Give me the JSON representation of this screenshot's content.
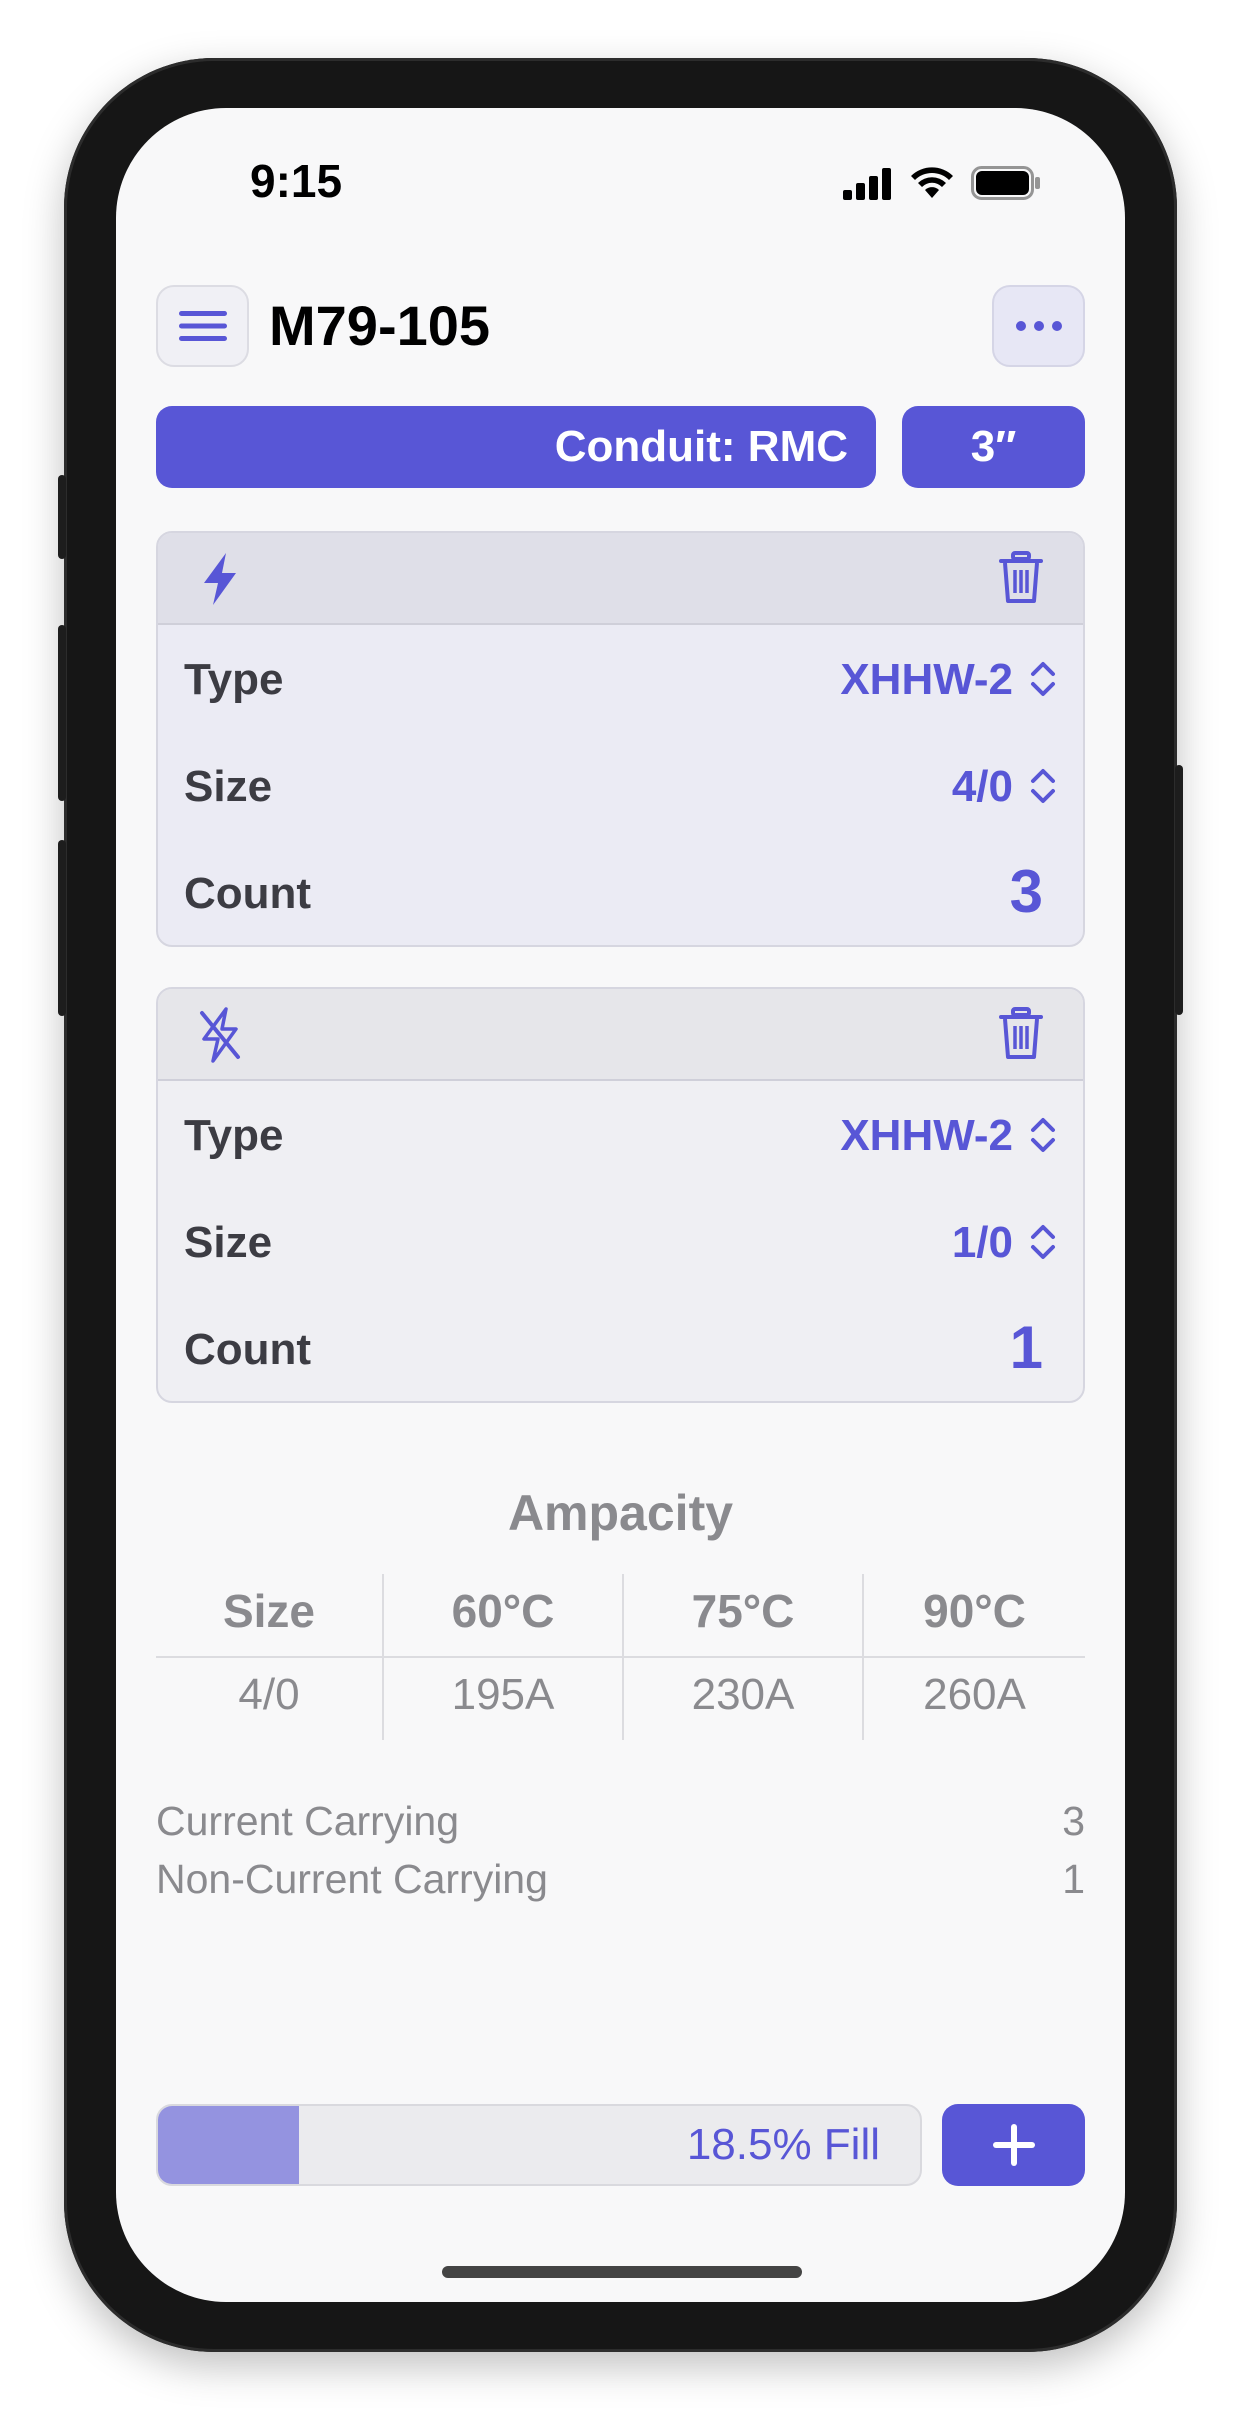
{
  "status_bar": {
    "time": "9:15"
  },
  "header": {
    "title": "M79-105"
  },
  "conduit": {
    "label": "Conduit: RMC",
    "size": "3″"
  },
  "conductors": [
    {
      "kind": "current-carrying",
      "type_label": "Type",
      "type": "XHHW-2",
      "size_label": "Size",
      "size": "4/0",
      "count_label": "Count",
      "count": "3"
    },
    {
      "kind": "non-current-carrying",
      "type_label": "Type",
      "type": "XHHW-2",
      "size_label": "Size",
      "size": "1/0",
      "count_label": "Count",
      "count": "1"
    }
  ],
  "ampacity": {
    "title": "Ampacity",
    "headers": [
      "Size",
      "60°C",
      "75°C",
      "90°C"
    ],
    "row": [
      "4/0",
      "195A",
      "230A",
      "260A"
    ]
  },
  "summary": {
    "current_label": "Current Carrying",
    "current_value": "3",
    "non_current_label": "Non-Current Carrying",
    "non_current_value": "1"
  },
  "fill": {
    "text": "18.5% Fill",
    "percent": 18.5
  },
  "colors": {
    "accent": "#5856d6",
    "fill": "#9493e0",
    "muted_text": "#8a8a8e"
  }
}
